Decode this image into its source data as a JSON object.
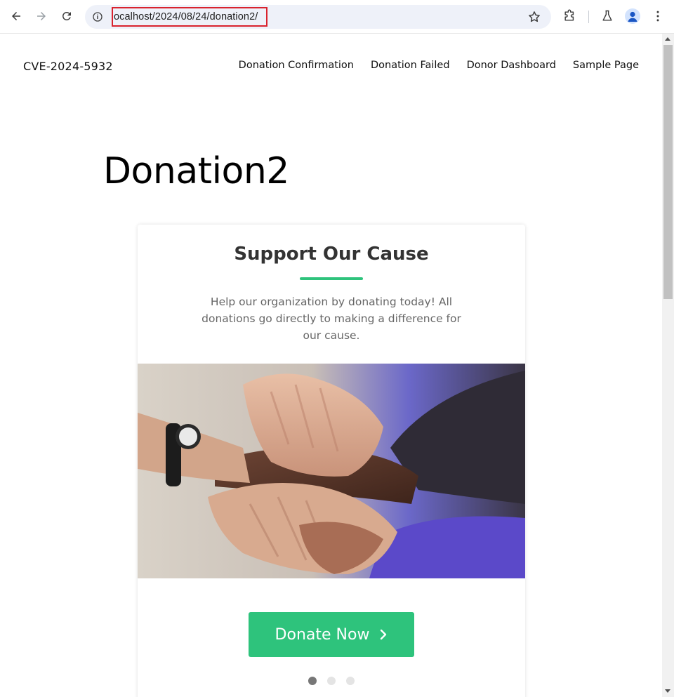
{
  "browser": {
    "url": "ocalhost/2024/08/24/donation2/",
    "back_icon": "arrow-left-icon",
    "forward_icon": "arrow-right-icon",
    "reload_icon": "reload-icon",
    "info_icon": "info-icon",
    "bookmark_icon": "star-icon",
    "extensions_icon": "puzzle-icon",
    "labs_icon": "flask-icon",
    "profile_icon": "person-icon",
    "menu_icon": "kebab-menu-icon"
  },
  "site": {
    "title": "CVE-2024-5932",
    "nav": [
      {
        "label": "Donation Confirmation"
      },
      {
        "label": "Donation Failed"
      },
      {
        "label": "Donor Dashboard"
      },
      {
        "label": "Sample Page"
      }
    ]
  },
  "page": {
    "title": "Donation2"
  },
  "card": {
    "title": "Support Our Cause",
    "description": "Help our organization by donating today! All donations go directly to making a difference for our cause.",
    "donate_label": "Donate Now",
    "accent_color": "#2ec37c",
    "carousel_dots": 3,
    "active_dot": 0
  }
}
